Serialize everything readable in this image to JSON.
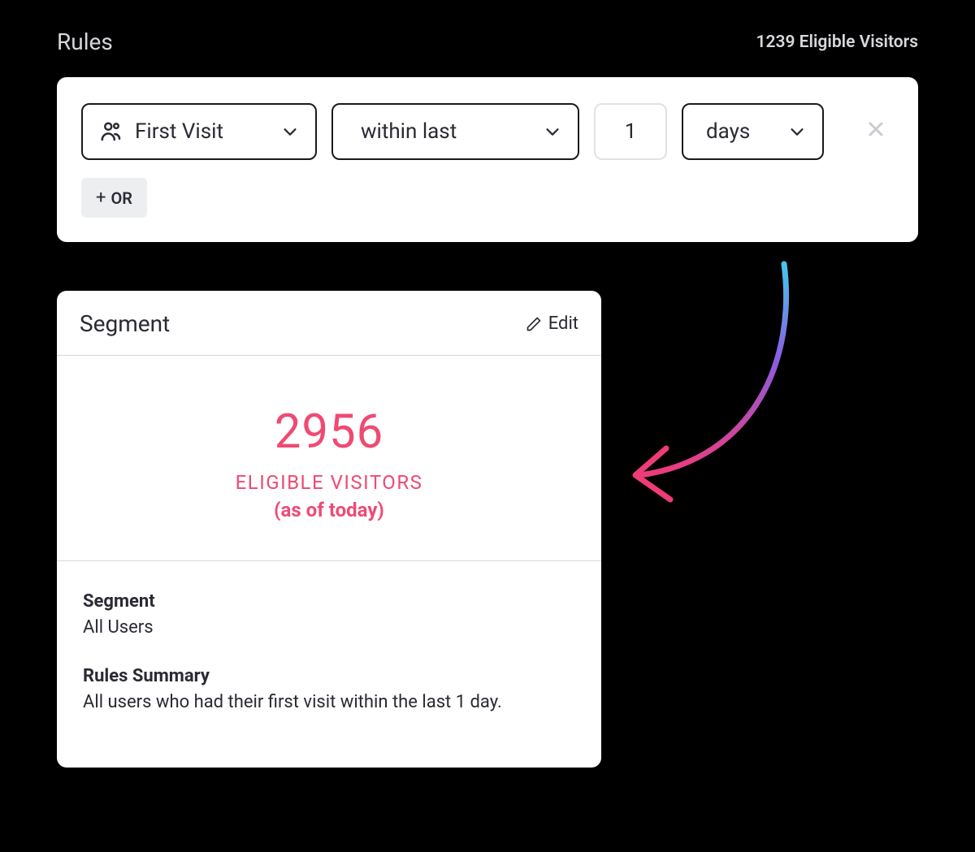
{
  "header": {
    "title": "Rules",
    "eligible": "1239 Eligible Visitors"
  },
  "rule": {
    "metric": "First Visit",
    "period": "within last",
    "value": "1",
    "unit": "days",
    "or_label": "OR"
  },
  "segment": {
    "title": "Segment",
    "edit_label": "Edit",
    "stat_value": "2956",
    "stat_label": "ELIGIBLE VISITORS",
    "stat_sub": "(as of today)",
    "body": {
      "seg_label": "Segment",
      "seg_value": "All Users",
      "rules_label": "Rules Summary",
      "rules_value": "All users who had their first visit within the last 1 day."
    }
  }
}
